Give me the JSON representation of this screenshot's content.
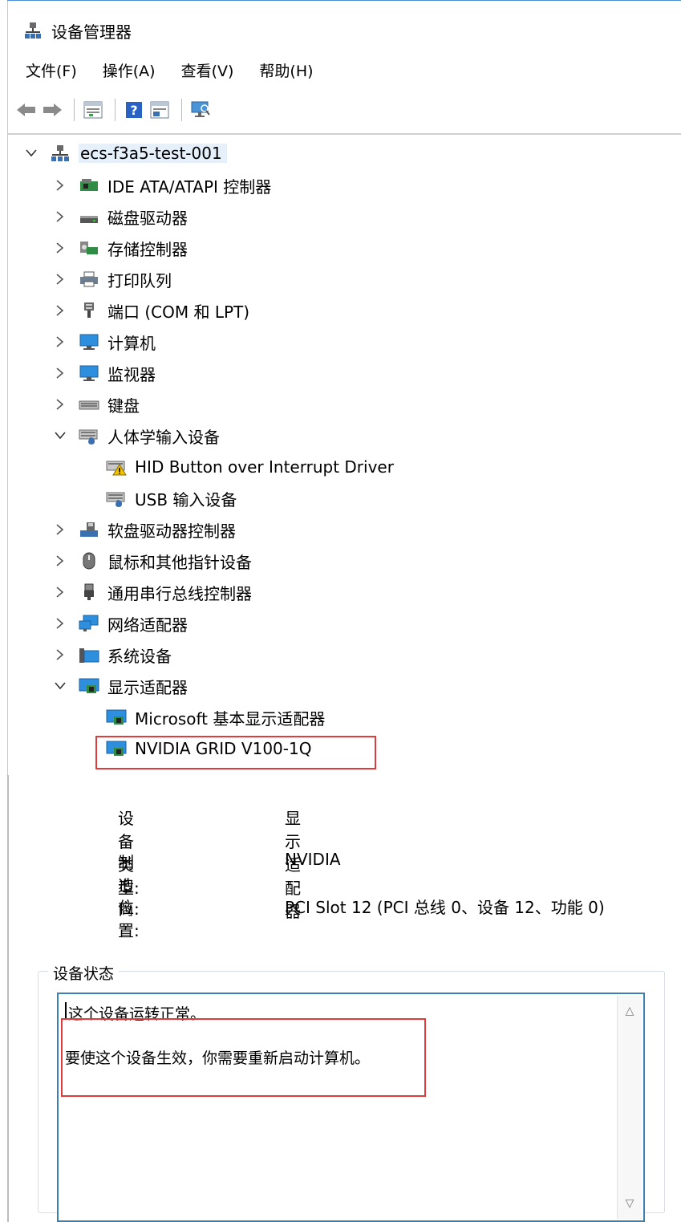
{
  "window": {
    "title": "设备管理器"
  },
  "menu": [
    "文件(F)",
    "操作(A)",
    "查看(V)",
    "帮助(H)"
  ],
  "tree": {
    "root": "ecs-f3a5-test-001",
    "items": [
      {
        "label": "IDE ATA/ATAPI 控制器",
        "icon": "ide-controller-icon",
        "expanded": false
      },
      {
        "label": "磁盘驱动器",
        "icon": "disk-drive-icon",
        "expanded": false
      },
      {
        "label": "存储控制器",
        "icon": "storage-controller-icon",
        "expanded": false
      },
      {
        "label": "打印队列",
        "icon": "printer-icon",
        "expanded": false
      },
      {
        "label": "端口 (COM 和 LPT)",
        "icon": "port-icon",
        "expanded": false
      },
      {
        "label": "计算机",
        "icon": "computer-icon",
        "expanded": false
      },
      {
        "label": "监视器",
        "icon": "monitor-icon",
        "expanded": false
      },
      {
        "label": "键盘",
        "icon": "keyboard-icon",
        "expanded": false
      },
      {
        "label": "人体学输入设备",
        "icon": "hid-icon",
        "expanded": true
      },
      {
        "label": "HID Button over Interrupt Driver",
        "icon": "hid-warning-icon",
        "child": true
      },
      {
        "label": "USB 输入设备",
        "icon": "hid-icon",
        "child": true
      },
      {
        "label": "软盘驱动器控制器",
        "icon": "floppy-controller-icon",
        "expanded": false
      },
      {
        "label": "鼠标和其他指针设备",
        "icon": "mouse-icon",
        "expanded": false
      },
      {
        "label": "通用串行总线控制器",
        "icon": "usb-icon",
        "expanded": false
      },
      {
        "label": "网络适配器",
        "icon": "network-adapter-icon",
        "expanded": false
      },
      {
        "label": "系统设备",
        "icon": "system-devices-icon",
        "expanded": false
      },
      {
        "label": "显示适配器",
        "icon": "display-adapter-icon",
        "expanded": true
      },
      {
        "label": "Microsoft 基本显示适配器",
        "icon": "display-adapter-icon",
        "child": true
      },
      {
        "label": "NVIDIA GRID V100-1Q",
        "icon": "display-adapter-icon",
        "child": true,
        "highlighted": true
      }
    ]
  },
  "properties": {
    "device_type_label": "设备类型:",
    "device_type_value": "显示适配器",
    "manufacturer_label": "制造商:",
    "manufacturer_value": "NVIDIA",
    "location_label": "位置:",
    "location_value": "PCI Slot 12 (PCI 总线 0、设备 12、功能 0)",
    "status_group_title": "设备状态",
    "status_line1": "这个设备运转正常。",
    "status_line2": "要使这个设备生效，你需要重新启动计算机。"
  },
  "colors": {
    "highlight_red": "#e03b3b",
    "selection_bg": "#e5f0fb",
    "status_border": "#3c7fb1"
  }
}
